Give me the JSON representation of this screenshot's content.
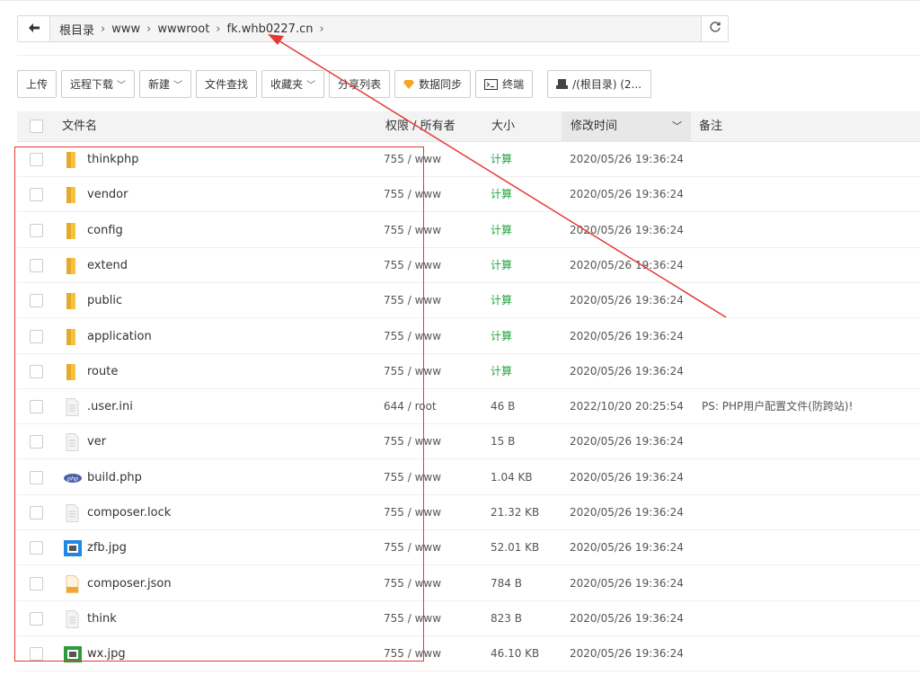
{
  "path": {
    "crumbs": [
      "根目录",
      "www",
      "wwwroot",
      "fk.whb0227.cn"
    ]
  },
  "toolbar": {
    "upload": "上传",
    "remote_download": "远程下载",
    "new": "新建",
    "file_search": "文件查找",
    "favorites": "收藏夹",
    "share_list": "分享列表",
    "data_sync": "数据同步",
    "terminal": "终端",
    "disk": "/(根目录) (2..."
  },
  "table": {
    "headers": {
      "name": "文件名",
      "perm": "权限 / 所有者",
      "size": "大小",
      "mtime": "修改时间",
      "note": "备注"
    },
    "rows": [
      {
        "name": "thinkphp",
        "type": "folder",
        "perm": "755 / www",
        "size": "计算",
        "mtime": "2020/05/26 19:36:24",
        "note": ""
      },
      {
        "name": "vendor",
        "type": "folder",
        "perm": "755 / www",
        "size": "计算",
        "mtime": "2020/05/26 19:36:24",
        "note": ""
      },
      {
        "name": "config",
        "type": "folder",
        "perm": "755 / www",
        "size": "计算",
        "mtime": "2020/05/26 19:36:24",
        "note": ""
      },
      {
        "name": "extend",
        "type": "folder",
        "perm": "755 / www",
        "size": "计算",
        "mtime": "2020/05/26 19:36:24",
        "note": ""
      },
      {
        "name": "public",
        "type": "folder",
        "perm": "755 / www",
        "size": "计算",
        "mtime": "2020/05/26 19:36:24",
        "note": ""
      },
      {
        "name": "application",
        "type": "folder",
        "perm": "755 / www",
        "size": "计算",
        "mtime": "2020/05/26 19:36:24",
        "note": ""
      },
      {
        "name": "route",
        "type": "folder",
        "perm": "755 / www",
        "size": "计算",
        "mtime": "2020/05/26 19:36:24",
        "note": ""
      },
      {
        "name": ".user.ini",
        "type": "file",
        "perm": "644 / root",
        "size": "46 B",
        "mtime": "2022/10/20 20:25:54",
        "note": "PS: PHP用户配置文件(防跨站)!"
      },
      {
        "name": "ver",
        "type": "file",
        "perm": "755 / www",
        "size": "15 B",
        "mtime": "2020/05/26 19:36:24",
        "note": ""
      },
      {
        "name": "build.php",
        "type": "php",
        "perm": "755 / www",
        "size": "1.04 KB",
        "mtime": "2020/05/26 19:36:24",
        "note": ""
      },
      {
        "name": "composer.lock",
        "type": "file",
        "perm": "755 / www",
        "size": "21.32 KB",
        "mtime": "2020/05/26 19:36:24",
        "note": ""
      },
      {
        "name": "zfb.jpg",
        "type": "image-blue",
        "perm": "755 / www",
        "size": "52.01 KB",
        "mtime": "2020/05/26 19:36:24",
        "note": ""
      },
      {
        "name": "composer.json",
        "type": "json",
        "perm": "755 / www",
        "size": "784 B",
        "mtime": "2020/05/26 19:36:24",
        "note": ""
      },
      {
        "name": "think",
        "type": "file",
        "perm": "755 / www",
        "size": "823 B",
        "mtime": "2020/05/26 19:36:24",
        "note": ""
      },
      {
        "name": "wx.jpg",
        "type": "image-green",
        "perm": "755 / www",
        "size": "46.10 KB",
        "mtime": "2020/05/26 19:36:24",
        "note": ""
      }
    ]
  },
  "colors": {
    "calc_green": "#20a53a",
    "folder_yellow": "#f5c342",
    "annotation_red": "#e53935"
  }
}
